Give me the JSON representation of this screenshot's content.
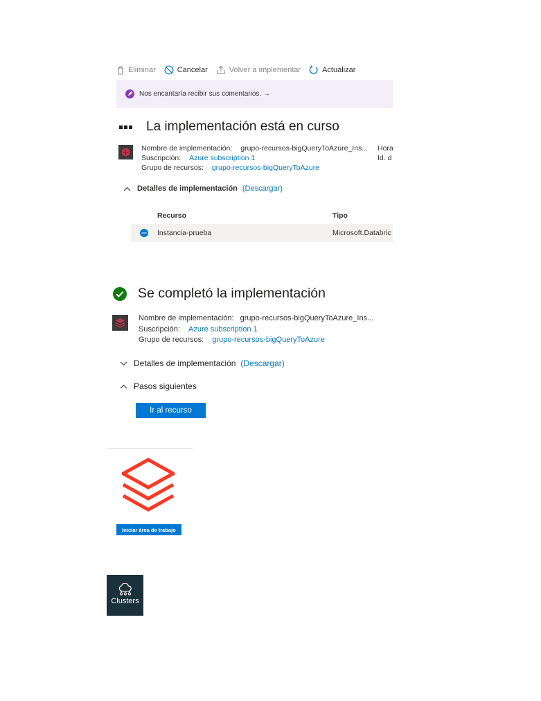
{
  "in_progress": {
    "toolbar": {
      "delete_label": "Eliminar",
      "cancel_label": "Cancelar",
      "redeploy_label": "Volver a implementar",
      "refresh_label": "Actualizar"
    },
    "feedback_text": "Nos encantaría recibir sus comentarios. →",
    "title": "La implementación está en curso",
    "deployment_name_label": "Nombre de implementación:",
    "deployment_name_value": "grupo-recursos-bigQueryToAzure_Ins...",
    "subscription_label": "Suscripción:",
    "subscription_value": "Azure subscription 1",
    "resource_group_label": "Grupo de recursos:",
    "resource_group_value": "grupo-recursos-bigQueryToAzure",
    "time_label": "Hora",
    "id_label": "Id. d",
    "details_label": "Detalles de implementación",
    "download_label": "(Descargar)",
    "table": {
      "col_resource": "Recurso",
      "col_type": "Tipo",
      "rows": [
        {
          "resource": "Instancia-prueba",
          "type": "Microsoft.Databric"
        }
      ]
    }
  },
  "completed": {
    "title": "Se completó la implementación",
    "deployment_name_label": "Nombre de implementación:",
    "deployment_name_value": "grupo-recursos-bigQueryToAzure_Ins...",
    "subscription_label": "Suscripción:",
    "subscription_value": "Azure subscription 1",
    "resource_group_label": "Grupo de recursos:",
    "resource_group_value": "grupo-recursos-bigQueryToAzure",
    "details_label": "Detalles de implementación",
    "download_label": "(Descargar)",
    "next_steps_label": "Pasos siguientes",
    "go_to_resource_label": "Ir al recurso"
  },
  "workspace": {
    "launch_label": "Iniciar área de trabajo"
  },
  "sidebar": {
    "clusters_label": "Clusters"
  },
  "colors": {
    "accent": "#0078d4",
    "success": "#107c10",
    "databricks_red": "#ff3621",
    "feedback_bg": "#f4eefa",
    "sidebar_bg": "#1b3139"
  }
}
